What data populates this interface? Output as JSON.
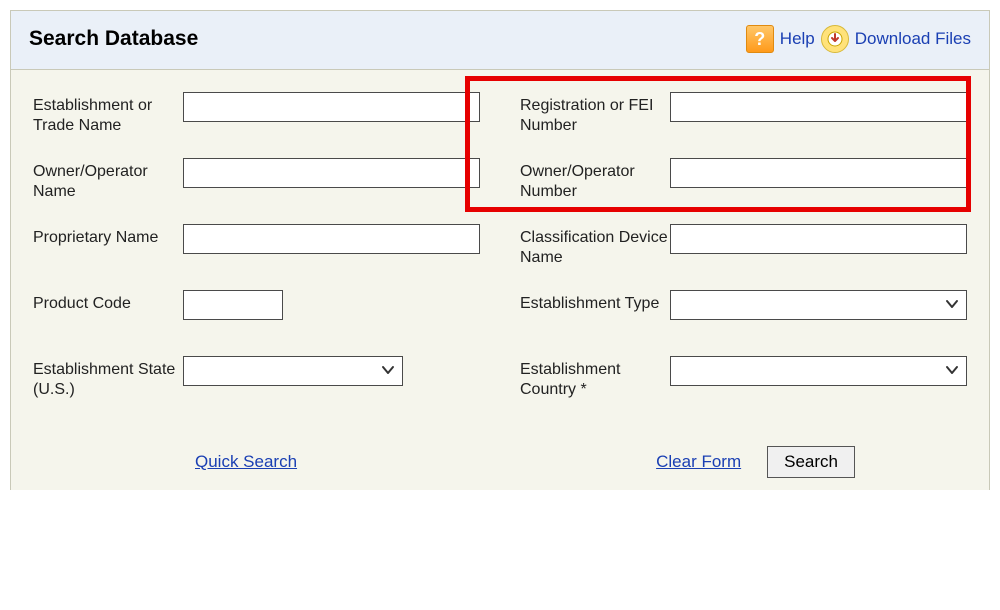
{
  "header": {
    "title": "Search Database",
    "help_label": "Help",
    "download_label": "Download Files"
  },
  "form": {
    "left": [
      {
        "label": "Establishment or Trade Name",
        "type": "text",
        "value": ""
      },
      {
        "label": "Owner/Operator Name",
        "type": "text",
        "value": ""
      },
      {
        "label": "Proprietary Name",
        "type": "text",
        "value": ""
      },
      {
        "label": "Product Code",
        "type": "text-short",
        "value": ""
      },
      {
        "label": "Establishment State (U.S.)",
        "type": "select-med",
        "value": ""
      }
    ],
    "right": [
      {
        "label": "Registration or FEI Number",
        "type": "text",
        "value": ""
      },
      {
        "label": "Owner/Operator Number",
        "type": "text",
        "value": ""
      },
      {
        "label": "Classification Device Name",
        "type": "text",
        "value": ""
      },
      {
        "label": "Establishment Type",
        "type": "select",
        "value": ""
      },
      {
        "label": "Establishment Country *",
        "type": "select",
        "value": ""
      }
    ]
  },
  "actions": {
    "quick_search": "Quick Search",
    "clear_form": "Clear Form",
    "search": "Search"
  },
  "highlight": {
    "description": "Red annotation box around Registration/FEI Number and Owner/Operator Number fields"
  }
}
